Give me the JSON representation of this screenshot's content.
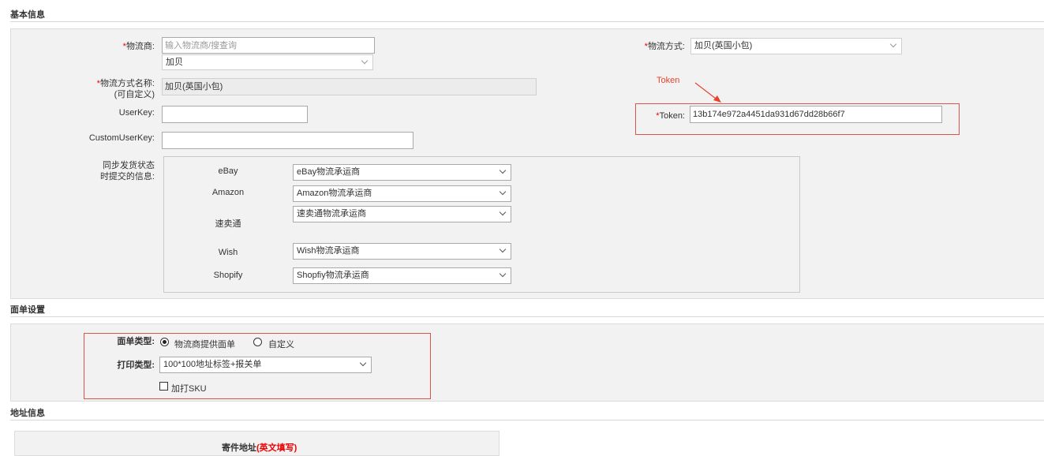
{
  "sections": {
    "basic": "基本信息",
    "label_settings": "面单设置",
    "address": "地址信息"
  },
  "basic": {
    "carrier": {
      "required": "*",
      "label": "物流商:",
      "search_placeholder": "输入物流商/搜查询",
      "selected": "加贝"
    },
    "method_name": {
      "required": "*",
      "label_line1": "物流方式名称:",
      "label_line2": "(可自定义)",
      "value": "加贝(英国小包)"
    },
    "userkey": {
      "label": "UserKey:",
      "value": ""
    },
    "customuserkey": {
      "label": "CustomUserKey:",
      "value": ""
    },
    "sync": {
      "label_line1": "同步发货状态",
      "label_line2": "时提交的信息:"
    },
    "platforms": [
      {
        "name": "eBay",
        "selected": "eBay物流承运商"
      },
      {
        "name": "Amazon",
        "selected": "Amazon物流承运商"
      },
      {
        "name": "速卖通",
        "selected": "速卖通物流承运商"
      },
      {
        "name": "Wish",
        "selected": "Wish物流承运商"
      },
      {
        "name": "Shopify",
        "selected": "Shopfiy物流承运商"
      }
    ],
    "shipping_method": {
      "required": "*",
      "label": "物流方式:",
      "selected": "加贝(英国小包)"
    },
    "token": {
      "required": "*",
      "label": "Token:",
      "value": "13b174e972a4451da931d67dd28b66f7"
    },
    "annotation": "Token"
  },
  "label_settings": {
    "type_label": "面单类型:",
    "type_options": [
      "物流商提供面单",
      "自定义"
    ],
    "type_selected": 0,
    "print_label": "打印类型:",
    "print_selected": "100*100地址标签+报关单",
    "sku_checkbox": "加打SKU",
    "sku_checked": false
  },
  "address": {
    "sender_title": "寄件地址",
    "sender_note": "(英文填写)"
  },
  "colors": {
    "annotation_red": "#e8412c",
    "required_red": "#ee0000",
    "panel_bg": "#f2f2f2"
  }
}
